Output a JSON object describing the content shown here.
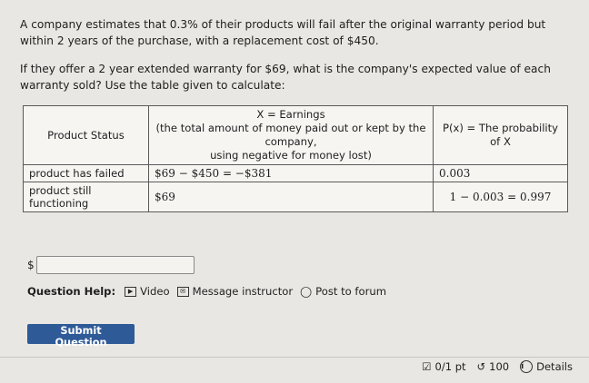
{
  "question": {
    "line1": "A company estimates that 0.3% of their products will fail after the original warranty period but within 2 years of the purchase, with a replacement cost of $450.",
    "line2": "If they offer a 2 year extended warranty for $69, what is the company's expected value of each warranty sold? Use the table given to calculate:"
  },
  "table": {
    "headers": {
      "status": "Product Status",
      "x_title": "X = Earnings",
      "x_desc": "(the total amount of money paid out or kept by the company,",
      "x_note": "using negative for money lost)",
      "p_title": "P(x) = The probability of X"
    },
    "rows": [
      {
        "status": "product has failed",
        "x": "$69 − $450 = −$381",
        "p": "0.003"
      },
      {
        "status": "product still functioning",
        "x": "$69",
        "p": "1 − 0.003 = 0.997"
      }
    ]
  },
  "answer": {
    "prefix": "$",
    "value": ""
  },
  "help": {
    "label": "Question Help:",
    "video": "Video",
    "message": "Message instructor",
    "forum": "Post to forum"
  },
  "submit_label": "Submit Question",
  "footer": {
    "score": "0/1 pt",
    "attempts": "100",
    "details": "Details"
  }
}
